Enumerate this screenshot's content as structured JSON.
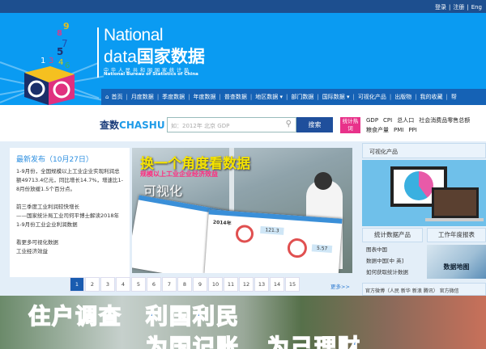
{
  "topbar": {
    "login": "登录",
    "register": "注册",
    "english": "Eng"
  },
  "header": {
    "title_en": "National",
    "title_data": "data",
    "title_cn": "国家数据",
    "subtitle_cn": "中华人民共和国国家统计局",
    "subtitle_en": "National Bureau of Statistics of China"
  },
  "nav": {
    "items": [
      "首页",
      "月度数据",
      "季度数据",
      "年度数据",
      "普查数据",
      "地区数据 ▾",
      "部门数据",
      "国际数据 ▾",
      "可视化产品",
      "出版物",
      "我的收藏",
      "帮"
    ]
  },
  "search": {
    "logo_cn": "查数",
    "logo_en": "CHASHU",
    "placeholder": "如：2012年 北京 GDP",
    "button": "搜索",
    "hot_tag": "统计热词",
    "hot_words": [
      "GDP",
      "CPI",
      "总人口",
      "社会消费品零售总额",
      "粮食产量",
      "PMI",
      "PPI"
    ]
  },
  "news": {
    "heading": "最新发布（10月27日）",
    "p1": "1-9月份，全国规模以上工业企业实现利润总额49713.4亿元，同比增长14.7%，增速比1-8月份放缓1.5个百分点。",
    "p2a": "前三季度工业利润较快增长",
    "p2b": "——国家统计局工业司何平博士解读2018年1-9月份工业企业利润数据",
    "p3a": "看更多可视化数据",
    "p3b": "工业经济效益"
  },
  "carousel": {
    "headline": "换一个角度看数据",
    "subline": "规模以上工业企业经济效益",
    "label": "可视化",
    "card_year": "2014年",
    "card_v1": "121.3",
    "card_v2": "5.57"
  },
  "pagination": {
    "pages": [
      "1",
      "2",
      "3",
      "4",
      "5",
      "6",
      "7",
      "8",
      "9",
      "10",
      "11",
      "12",
      "13",
      "14",
      "15"
    ],
    "current": "1",
    "more": "更多>>"
  },
  "right": {
    "title": "可视化产品",
    "tab1": "统计数据产品",
    "tab2": "工作年度报表",
    "links": [
      "图表中国",
      "数据中国[中 英]",
      "如何获取统计数据"
    ],
    "map_label": "数据地图",
    "bottom": "官方微博（人民 新华 新浪 腾讯） 官方微信"
  },
  "banner": {
    "line1a": "住户调查",
    "line1b": "利国利民",
    "line2a": "为国记账",
    "line2b": "为己理财"
  }
}
